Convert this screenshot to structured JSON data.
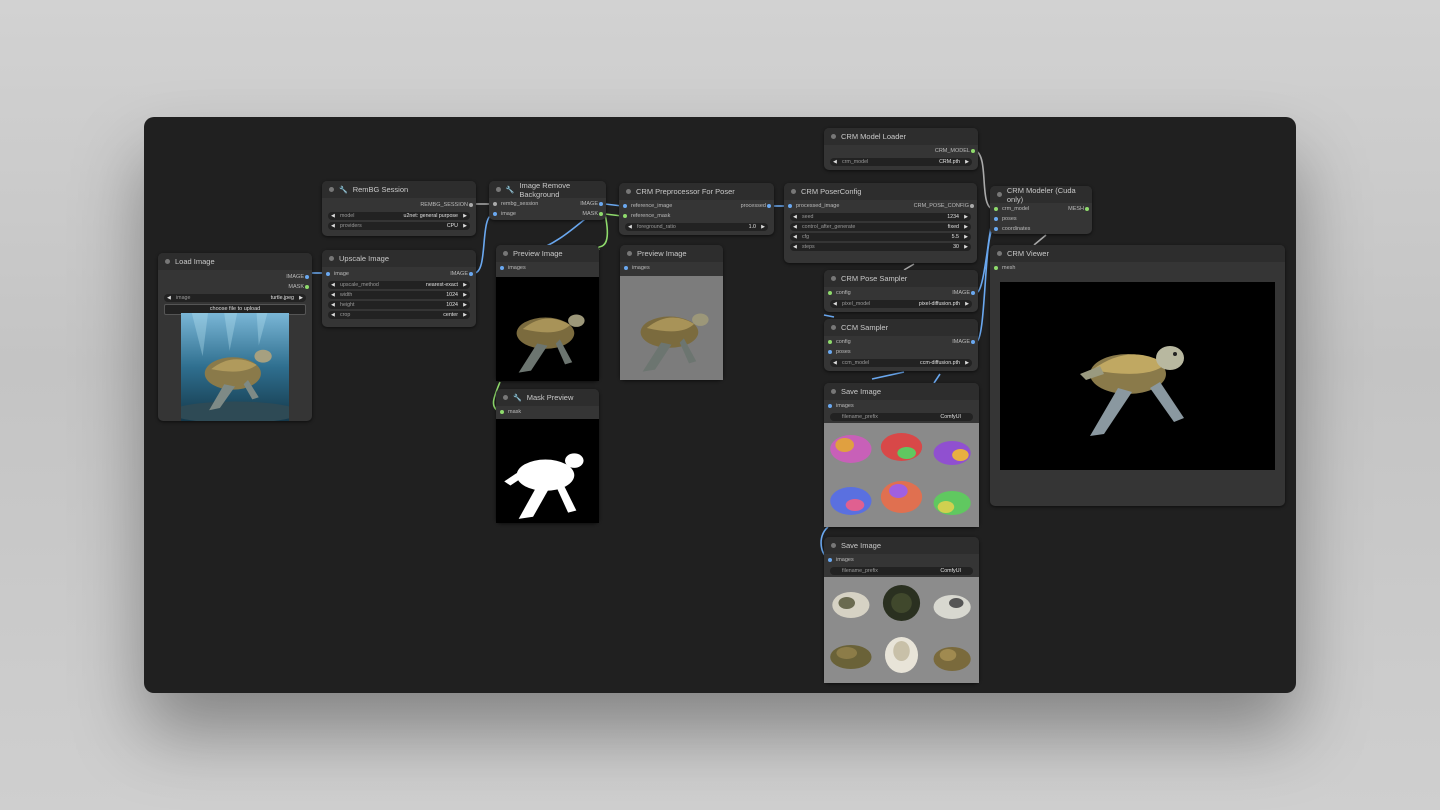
{
  "nodes": {
    "load_image": {
      "title": "Load Image",
      "outputs": [
        "IMAGE",
        "MASK"
      ],
      "widget": {
        "label": "image",
        "value": "turtle.jpeg"
      },
      "upload_button": "choose file to upload"
    },
    "rembg_session": {
      "title": "RemBG Session",
      "output": "REMBG_SESSION",
      "widgets": [
        {
          "label": "model",
          "value": "u2net: general purpose"
        },
        {
          "label": "providers",
          "value": "CPU"
        }
      ]
    },
    "upscale_image": {
      "title": "Upscale Image",
      "input": "image",
      "output": "IMAGE",
      "widgets": [
        {
          "label": "upscale_method",
          "value": "nearest-exact"
        },
        {
          "label": "width",
          "value": "1024"
        },
        {
          "label": "height",
          "value": "1024"
        },
        {
          "label": "crop",
          "value": "center"
        }
      ]
    },
    "image_remove_background": {
      "title": "Image Remove Background",
      "inputs": [
        "rembg_session",
        "image"
      ],
      "outputs": [
        "IMAGE",
        "MASK"
      ]
    },
    "preview_image_1": {
      "title": "Preview Image",
      "input": "images"
    },
    "mask_preview": {
      "title": "Mask Preview",
      "input": "mask"
    },
    "crm_preprocessor": {
      "title": "CRM Preprocessor For Poser",
      "inputs": [
        "reference_image",
        "reference_mask"
      ],
      "output": "processed",
      "widget": {
        "label": "foreground_ratio",
        "value": "1.0"
      }
    },
    "preview_image_2": {
      "title": "Preview Image",
      "input": "images"
    },
    "crm_model_loader": {
      "title": "CRM Model Loader",
      "output": "CRM_MODEL",
      "widget": {
        "label": "crm_model",
        "value": "CRM.pth"
      }
    },
    "crm_poser_config": {
      "title": "CRM PoserConfig",
      "input": "processed_image",
      "output": "CRM_POSE_CONFIG",
      "widgets": [
        {
          "label": "seed",
          "value": "1234"
        },
        {
          "label": "control_after_generate",
          "value": "fixed"
        },
        {
          "label": "cfg",
          "value": "5.5"
        },
        {
          "label": "steps",
          "value": "30"
        }
      ]
    },
    "crm_pose_sampler": {
      "title": "CRM Pose Sampler",
      "input": "config",
      "output": "IMAGE",
      "widget": {
        "label": "pixel_model",
        "value": "pixel-diffusion.pth"
      }
    },
    "ccm_sampler": {
      "title": "CCM Sampler",
      "inputs": [
        "config",
        "poses"
      ],
      "output": "IMAGE",
      "widget": {
        "label": "ccm_model",
        "value": "ccm-diffusion.pth"
      }
    },
    "crm_modeler": {
      "title": "CRM Modeler (Cuda only)",
      "inputs": [
        "crm_model",
        "poses",
        "coordinates"
      ],
      "output": "MESH"
    },
    "crm_viewer": {
      "title": "CRM Viewer",
      "input": "mesh"
    },
    "save_image_1": {
      "title": "Save Image",
      "input": "images",
      "widget": {
        "label": "filename_prefix",
        "value": "ComfyUI"
      }
    },
    "save_image_2": {
      "title": "Save Image",
      "input": "images",
      "widget": {
        "label": "filename_prefix",
        "value": "ComfyUI"
      }
    }
  },
  "colors": {
    "image_link": "#6aa8f0",
    "mask_link": "#8fdb6c",
    "model_link": "#aaaaaa",
    "node_bg": "#353535",
    "canvas_bg": "#202020"
  }
}
